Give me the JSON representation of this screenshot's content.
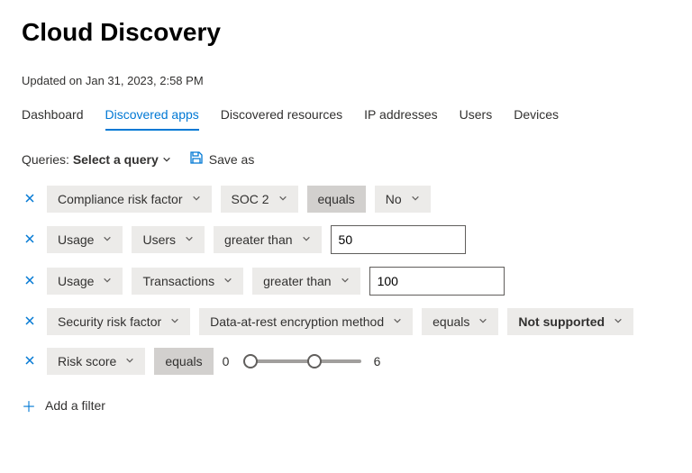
{
  "header": {
    "title": "Cloud Discovery",
    "updated": "Updated on Jan 31, 2023, 2:58 PM"
  },
  "tabs": [
    {
      "label": "Dashboard",
      "active": false
    },
    {
      "label": "Discovered apps",
      "active": true
    },
    {
      "label": "Discovered resources",
      "active": false
    },
    {
      "label": "IP addresses",
      "active": false
    },
    {
      "label": "Users",
      "active": false
    },
    {
      "label": "Devices",
      "active": false
    }
  ],
  "queries": {
    "label": "Queries:",
    "select_label": "Select a query",
    "save_as_label": "Save as"
  },
  "filters": [
    {
      "field": "Compliance risk factor",
      "subfield": "SOC 2",
      "operator": "equals",
      "operator_dark": true,
      "value_pill": "No"
    },
    {
      "field": "Usage",
      "subfield": "Users",
      "operator": "greater than",
      "value_input": "50"
    },
    {
      "field": "Usage",
      "subfield": "Transactions",
      "operator": "greater than",
      "value_input": "100"
    },
    {
      "field": "Security risk factor",
      "subfield": "Data-at-rest encryption method",
      "operator": "equals",
      "value_pill": "Not supported",
      "value_pill_bold": true
    },
    {
      "field": "Risk score",
      "operator": "equals",
      "operator_dark": true,
      "slider": {
        "min_display": "0",
        "max_display": "6",
        "low_pct": 6,
        "high_pct": 60
      }
    }
  ],
  "add_filter_label": "Add a filter"
}
